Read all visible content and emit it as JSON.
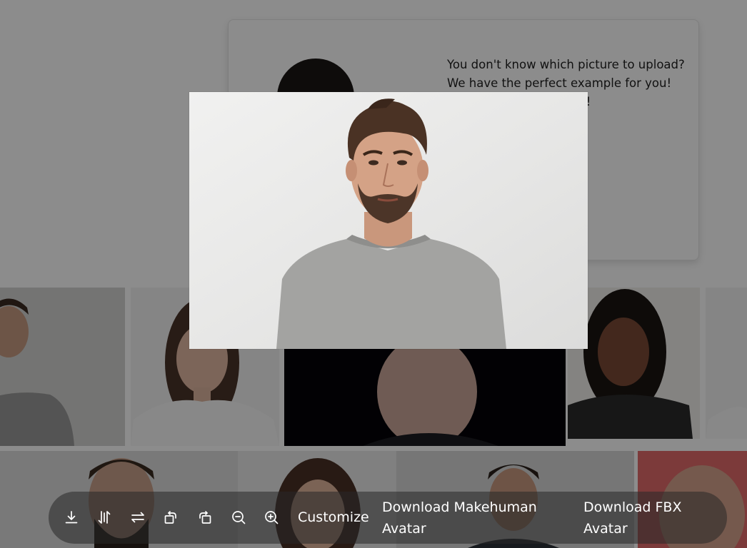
{
  "example_card": {
    "text": "You don't know which picture to upload? We have the perfect example for you! Here is our support guy!"
  },
  "preview": {
    "image_label": "man-in-grey-tshirt-photo"
  },
  "toolbar": {
    "icons": [
      "download-icon",
      "flip-vertical-icon",
      "flip-horizontal-icon",
      "rotate-left-icon",
      "rotate-right-icon",
      "zoom-out-icon",
      "zoom-in-icon"
    ],
    "customize_label": "Customize",
    "download_makehuman_label": "Download Makehuman Avatar",
    "download_fbx_label": "Download FBX Avatar"
  },
  "colors": {
    "mask": "#000000",
    "toolbar_bg": "#282828",
    "toolbar_text": "#ffffff"
  }
}
